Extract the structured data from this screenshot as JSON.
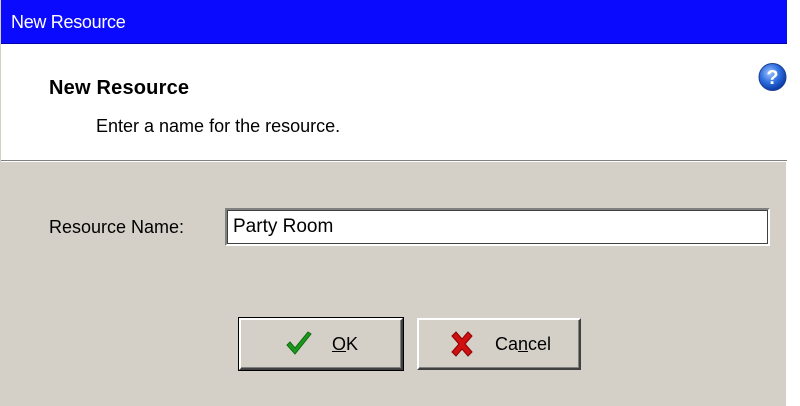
{
  "window": {
    "title": "New Resource"
  },
  "header": {
    "title": "New Resource",
    "description": "Enter a name for the resource."
  },
  "icons": {
    "help": "help-question-icon",
    "ok": "green-checkmark-icon",
    "cancel": "red-x-icon"
  },
  "form": {
    "resource_name_label": "Resource Name:",
    "resource_name_value": "Party Room"
  },
  "buttons": {
    "ok_label": "OK",
    "ok_mnemonic": "O",
    "ok_rest": "K",
    "cancel_label": "Cancel",
    "cancel_pre": "Ca",
    "cancel_mnemonic": "n",
    "cancel_post": "cel"
  },
  "colors": {
    "titlebar": "#0a0aff",
    "dialog_face": "#d4d0c8",
    "header_bg": "#ffffff",
    "ok_check": "#1a9a1a",
    "cancel_x": "#d01010"
  }
}
